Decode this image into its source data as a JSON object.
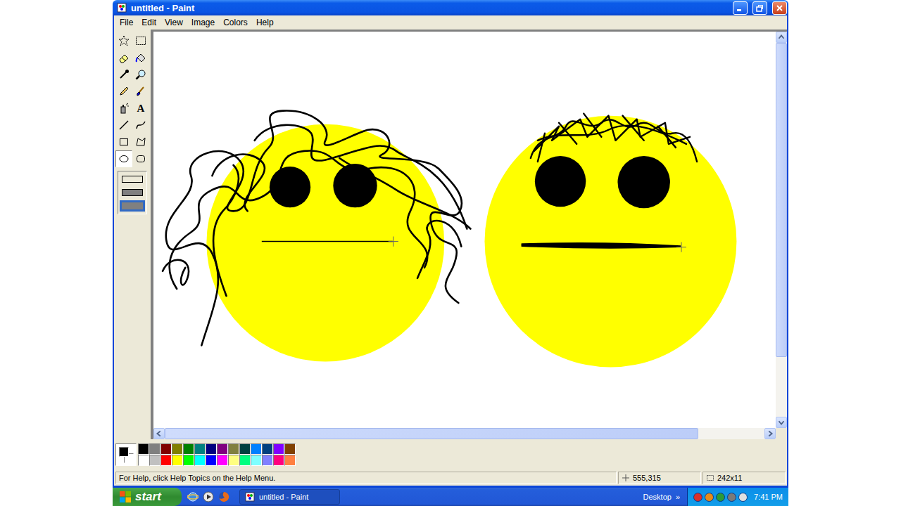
{
  "window": {
    "title": "untitled - Paint"
  },
  "menu": [
    "File",
    "Edit",
    "View",
    "Image",
    "Colors",
    "Help"
  ],
  "tools": [
    {
      "selected": false
    },
    {
      "selected": false
    },
    {
      "selected": false
    },
    {
      "selected": false
    },
    {
      "selected": false
    },
    {
      "selected": false
    },
    {
      "selected": false
    },
    {
      "selected": false
    },
    {
      "selected": false
    },
    {
      "selected": false,
      "glyph": "A"
    },
    {
      "selected": false
    },
    {
      "selected": false
    },
    {
      "selected": false
    },
    {
      "selected": false
    },
    {
      "selected": true
    },
    {
      "selected": false
    }
  ],
  "fill_styles": [
    {
      "selected": false
    },
    {
      "selected": false
    },
    {
      "selected": true
    }
  ],
  "scrollbars": {
    "vertical": {
      "level": 0.84
    },
    "horizontal": {
      "level": 0.89
    }
  },
  "colors": {
    "foreground": "#000000",
    "background": "#ffffff"
  },
  "palette": [
    {
      "color": "#000000"
    },
    {
      "color": "#808080"
    },
    {
      "color": "#800000"
    },
    {
      "color": "#808000"
    },
    {
      "color": "#008000"
    },
    {
      "color": "#008080"
    },
    {
      "color": "#000080"
    },
    {
      "color": "#800080"
    },
    {
      "color": "#808040"
    },
    {
      "color": "#004040"
    },
    {
      "color": "#0080ff"
    },
    {
      "color": "#004080"
    },
    {
      "color": "#8000ff"
    },
    {
      "color": "#804000"
    },
    {
      "color": "#ffffff"
    },
    {
      "color": "#c0c0c0"
    },
    {
      "color": "#ff0000"
    },
    {
      "color": "#ffff00"
    },
    {
      "color": "#00ff00"
    },
    {
      "color": "#00ffff"
    },
    {
      "color": "#0000ff"
    },
    {
      "color": "#ff00ff"
    },
    {
      "color": "#ffff80"
    },
    {
      "color": "#00ff80"
    },
    {
      "color": "#80ffff"
    },
    {
      "color": "#8080ff"
    },
    {
      "color": "#ff0080"
    },
    {
      "color": "#ff8040"
    }
  ],
  "status_bar": {
    "help": "For Help, click Help Topics on the Help Menu.",
    "position": "555,315",
    "size": "242x11"
  },
  "taskbar": {
    "start": "start",
    "tasks": [
      {
        "label": "untitled - Paint",
        "selected": true
      }
    ],
    "toolbar": "Desktop",
    "chevron": "»",
    "clock": "7:41 PM"
  }
}
